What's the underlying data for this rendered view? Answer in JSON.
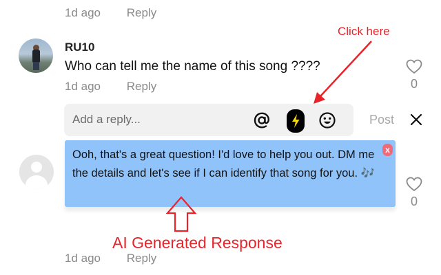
{
  "top_meta": {
    "age": "1d ago",
    "reply_label": "Reply"
  },
  "comment": {
    "username": "RU10",
    "text": "Who can tell me the name of this song ????",
    "age": "1d ago",
    "reply_label": "Reply",
    "likes": "0"
  },
  "reply_box": {
    "placeholder": "Add a reply...",
    "icons": [
      "at-sign-icon",
      "lightning-bolt-icon",
      "emoji-icon"
    ],
    "post_label": "Post"
  },
  "ai_response": {
    "text": "Ooh, that's a great question! I'd love to help you out. DM me the details and let's see if I can identify that song for you. 🎶",
    "close_label": "x"
  },
  "next_comment": {
    "likes": "0"
  },
  "bottom_meta": {
    "age": "1d ago",
    "reply_label": "Reply"
  },
  "annotations": {
    "click_here": "Click here",
    "ai_generated": "AI Generated Response",
    "color": "#e8232a"
  },
  "colors": {
    "ai_bubble": "#91c3fb",
    "bolt_button": "#000000",
    "bolt_icon": "#f5d90a",
    "meta_text": "#8a8a8a"
  }
}
